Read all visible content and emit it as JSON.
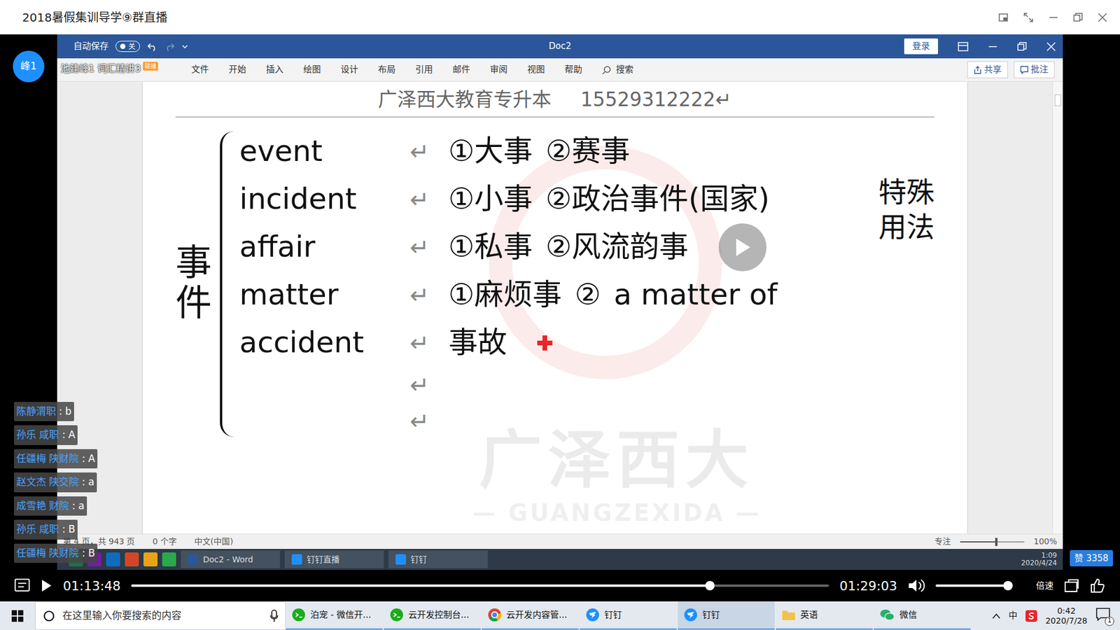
{
  "window": {
    "title": "2018暑假集训导学⑨群直播"
  },
  "presenter": {
    "avatar": "峰1",
    "live_title": "池建峰1 词汇精讲3",
    "badge": "联播"
  },
  "word": {
    "autosave_label": "自动保存",
    "autosave_on": false,
    "autosave_state": "关",
    "doc_title": "Doc2",
    "login": "登录",
    "tabs": [
      {
        "label": "文件",
        "selected": false
      },
      {
        "label": "开始",
        "selected": false
      },
      {
        "label": "插入",
        "selected": false
      },
      {
        "label": "绘图",
        "selected": false
      },
      {
        "label": "设计",
        "selected": false
      },
      {
        "label": "布局",
        "selected": false
      },
      {
        "label": "引用",
        "selected": false
      },
      {
        "label": "邮件",
        "selected": false
      },
      {
        "label": "审阅",
        "selected": false
      },
      {
        "label": "视图",
        "selected": false
      },
      {
        "label": "帮助",
        "selected": false
      }
    ],
    "search": "搜索",
    "share": "共享",
    "comments": "批注",
    "status": {
      "page": "第 4 页，共 943 页",
      "words": "0 个字",
      "language": "中文(中国)",
      "focus": "专注",
      "zoom": "100%",
      "zoom_level": 0.55
    }
  },
  "document": {
    "header": "广泽西大教育专升本",
    "phone": "15529312222",
    "return_mark": "↵",
    "topic": "事件",
    "note": "特殊用法",
    "entries": [
      {
        "word": "event",
        "mark": "↵",
        "senses": [
          "①大事",
          "②赛事"
        ]
      },
      {
        "word": "incident",
        "mark": "↵",
        "senses": [
          "①小事",
          "②政治事件(国家)"
        ]
      },
      {
        "word": "affair",
        "mark": "↵",
        "senses": [
          "①私事",
          "②风流韵事"
        ]
      },
      {
        "word": "matter",
        "mark": "↵",
        "senses": [
          "①麻烦事",
          "②",
          "a matter of"
        ]
      },
      {
        "word": "accident",
        "mark": "↵",
        "senses": [
          "事故"
        ]
      }
    ],
    "blank_lines": [
      {
        "mark": "↵"
      },
      {
        "mark": "↵"
      }
    ],
    "watermark": {
      "text": "广泽西大",
      "sub": "— GUANGZEXIDA —"
    }
  },
  "recording_taskbar": {
    "items": [
      {
        "label": "Doc2 - Word"
      },
      {
        "label": "钉钉直播"
      },
      {
        "label": "钉钉"
      }
    ],
    "time": "1:09",
    "date": "2020/4/24"
  },
  "player": {
    "current": "01:13:48",
    "total": "01:29:03",
    "progress": 0.829,
    "volume": 0.95,
    "speed": "倍速",
    "playing": false
  },
  "likes": {
    "label": "赞",
    "count": "3358"
  },
  "chat": {
    "separator": ":",
    "messages": [
      {
        "sender": "陈静渭职",
        "text": "b"
      },
      {
        "sender": "孙乐 咸职",
        "text": "A"
      },
      {
        "sender": "任疆梅 陕财院",
        "text": "A"
      },
      {
        "sender": "赵文杰 陕交院",
        "text": "a"
      },
      {
        "sender": "成雪艳 财院",
        "text": "a"
      },
      {
        "sender": "孙乐 咸职",
        "text": "B"
      },
      {
        "sender": "任疆梅 陕财院",
        "text": "B"
      }
    ]
  },
  "taskbar": {
    "search_placeholder": "在这里输入你要搜索的内容",
    "apps": [
      {
        "label": "泊宠 - 微信开...",
        "kind": "wxdev",
        "selected": false
      },
      {
        "label": "云开发控制台...",
        "kind": "wxdev",
        "selected": false
      },
      {
        "label": "云开发内容管...",
        "kind": "chrome",
        "selected": false
      },
      {
        "label": "钉钉",
        "kind": "dingtalk",
        "selected": false
      },
      {
        "label": "钉钉",
        "kind": "dingtalk",
        "selected": true
      },
      {
        "label": "英语",
        "kind": "folder",
        "selected": false
      },
      {
        "label": "微信",
        "kind": "wechat",
        "selected": false
      }
    ],
    "ime": "中",
    "time": "0:42",
    "date": "2020/7/28",
    "notifications": "1"
  }
}
